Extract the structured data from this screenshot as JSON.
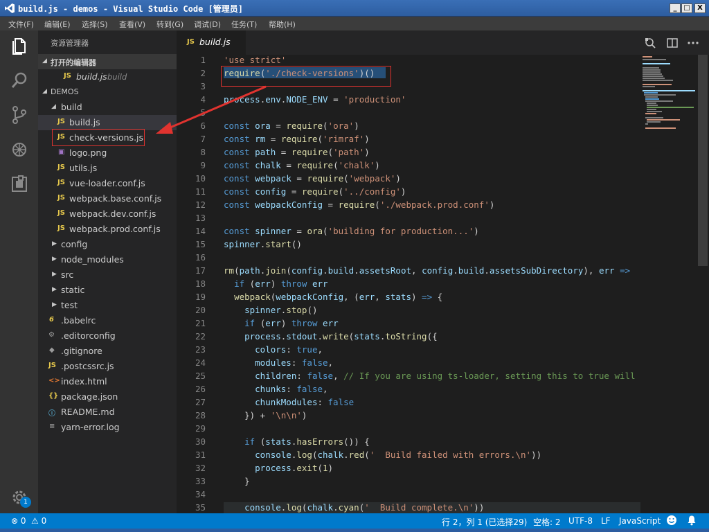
{
  "window": {
    "title": "build.js - demos - Visual Studio Code [管理员]",
    "min": "_",
    "max": "□",
    "close": "X"
  },
  "menu": [
    "文件(F)",
    "编辑(E)",
    "选择(S)",
    "查看(V)",
    "转到(G)",
    "调试(D)",
    "任务(T)",
    "帮助(H)"
  ],
  "sidebar": {
    "header": "资源管理器",
    "open_editors_label": "打开的编辑器",
    "open_editor": {
      "icon": "JS",
      "name": "build.js",
      "desc": "build"
    },
    "root_label": "DEMOS",
    "build_folder": "build",
    "files": [
      {
        "icon": "JS",
        "name": "build.js"
      },
      {
        "icon": "JS",
        "name": "check-versions.js"
      },
      {
        "icon": "▣",
        "name": "logo.png"
      },
      {
        "icon": "JS",
        "name": "utils.js"
      },
      {
        "icon": "JS",
        "name": "vue-loader.conf.js"
      },
      {
        "icon": "JS",
        "name": "webpack.base.conf.js"
      },
      {
        "icon": "JS",
        "name": "webpack.dev.conf.js"
      },
      {
        "icon": "JS",
        "name": "webpack.prod.conf.js"
      }
    ],
    "folders": [
      "config",
      "node_modules",
      "src",
      "static",
      "test"
    ],
    "root_files": [
      {
        "icon": "6",
        "name": ".babelrc"
      },
      {
        "icon": "⚙",
        "name": ".editorconfig"
      },
      {
        "icon": "◆",
        "name": ".gitignore"
      },
      {
        "icon": "JS",
        "name": ".postcssrc.js"
      },
      {
        "icon": "<>",
        "name": "index.html"
      },
      {
        "icon": "{}",
        "name": "package.json"
      },
      {
        "icon": "ⓘ",
        "name": "README.md"
      },
      {
        "icon": "≡",
        "name": "yarn-error.log"
      }
    ]
  },
  "tab": {
    "icon": "JS",
    "name": "build.js"
  },
  "editor": {
    "line_numbers": [
      "1",
      "2",
      "3",
      "4",
      "5",
      "6",
      "7",
      "8",
      "9",
      "10",
      "11",
      "12",
      "13",
      "14",
      "15",
      "16",
      "17",
      "18",
      "19",
      "20",
      "21",
      "22",
      "23",
      "24",
      "25",
      "26",
      "27",
      "28",
      "29",
      "30",
      "31",
      "32",
      "33",
      "34",
      "35"
    ]
  },
  "status": {
    "errors": "0",
    "warnings": "0",
    "position": "行 2，列 1 (已选择29)",
    "indent": "空格: 2",
    "encoding": "UTF-8",
    "eol": "LF",
    "language": "JavaScript"
  },
  "activity": {
    "badge": "1"
  }
}
